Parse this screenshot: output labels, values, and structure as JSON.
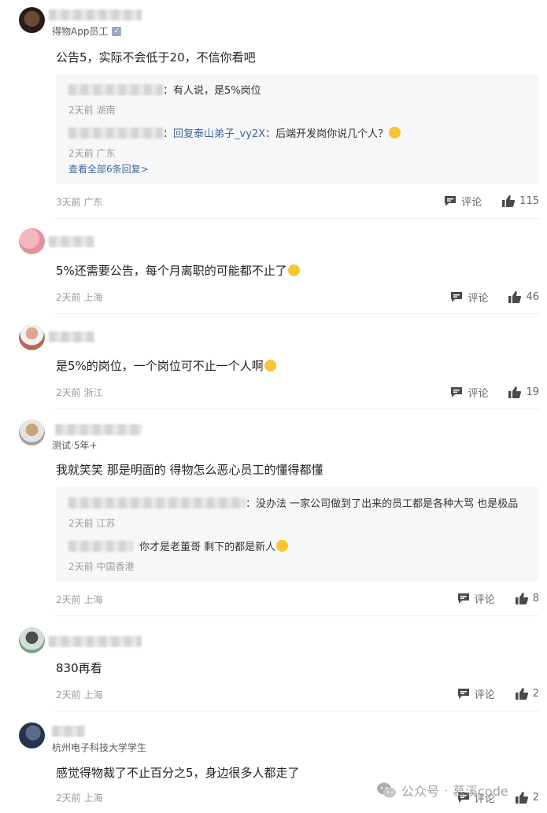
{
  "comments": [
    {
      "badge": "得物App员工",
      "text": "公告5，实际不会低于20，不信你看吧",
      "meta": "3天前 广东",
      "comment_label": "评论",
      "likes": "115",
      "replies": [
        {
          "text": "：有人说，是5%岗位",
          "meta": "2天前 湖南"
        },
        {
          "text_prefix": "：",
          "link": "回复泰山弟子_vy2X",
          "text": "：后端开发岗你说几个人？",
          "meta": "2天前 广东"
        }
      ],
      "more": "查看全部6条回复>"
    },
    {
      "text": "5%还需要公告，每个月离职的可能都不止了",
      "meta": "2天前 上海",
      "comment_label": "评论",
      "likes": "46"
    },
    {
      "text": "是5%的岗位，一个岗位可不止一个人啊",
      "meta": "2天前 浙江",
      "comment_label": "评论",
      "likes": "19"
    },
    {
      "badge": "测试·5年+",
      "text": "我就笑笑 那是明面的 得物怎么恶心员工的懂得都懂",
      "meta": "2天前 上海",
      "comment_label": "评论",
      "likes": "8",
      "replies": [
        {
          "text": "：没办法 一家公司做到了出来的员工都是各种大骂 也是极品",
          "meta": "2天前 江苏"
        },
        {
          "text": "你才是老董哥 剩下的都是新人",
          "meta": "2天前 中国香港"
        }
      ]
    },
    {
      "text": "830再看",
      "meta": "2天前 上海",
      "comment_label": "评论",
      "likes": "2"
    },
    {
      "badge": "杭州电子科技大学学生",
      "text": "感觉得物裁了不止百分之5，身边很多人都走了",
      "meta": "2天前 上海",
      "comment_label": "评论",
      "likes": "2"
    }
  ],
  "watermark": {
    "prefix": "公众号",
    "sep": "·",
    "name": "慕溪code"
  },
  "colors": {
    "link": "#406599",
    "meta": "#9a9a9a",
    "reply_bg": "#f6f7f9"
  },
  "icons": [
    "comment-icon",
    "thumbs-up-icon",
    "verified-icon",
    "wechat-icon"
  ]
}
